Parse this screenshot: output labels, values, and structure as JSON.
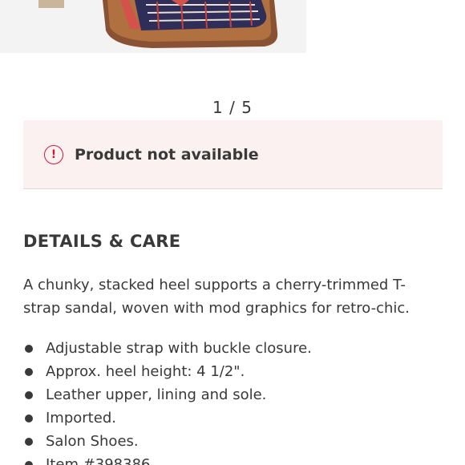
{
  "product_image": {
    "icon": "sandal-image"
  },
  "gallery": {
    "pager_text": "1 / 5"
  },
  "alert": {
    "icon": "alert-circle-icon",
    "icon_glyph": "!",
    "message": "Product not available",
    "accent_color": "#d0183a"
  },
  "details": {
    "title": "DETAILS & CARE",
    "description": "A chunky, stacked heel supports a cherry-trimmed T-strap sandal, woven with mod graphics for retro-chic.",
    "bullets": [
      "Adjustable strap with buckle closure.",
      "Approx. heel height: 4 1/2\".",
      "Leather upper, lining and sole.",
      "Imported.",
      "Salon Shoes.",
      "Item #398386"
    ]
  }
}
